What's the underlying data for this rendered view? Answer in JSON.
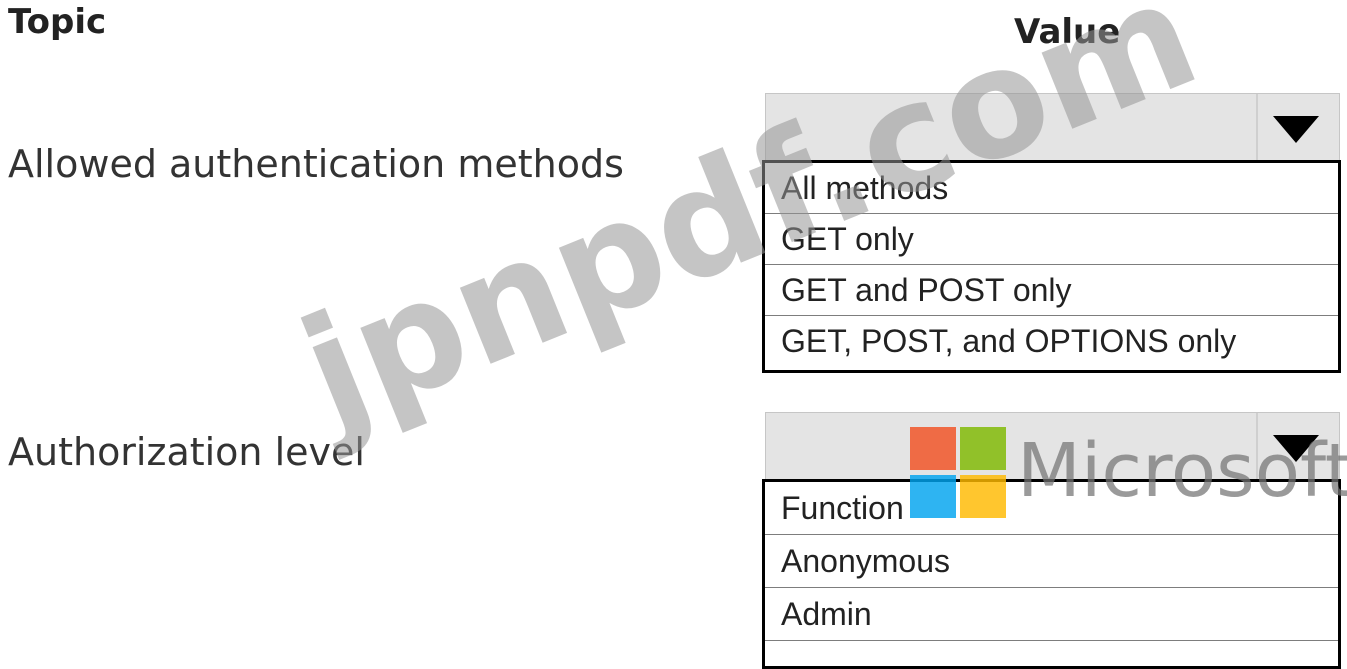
{
  "headers": {
    "topic": "Topic",
    "value": "Value"
  },
  "topics": [
    {
      "label": "Allowed authentication methods",
      "selected_value": "",
      "options": [
        "All methods",
        "GET only",
        "GET and POST only",
        "GET, POST, and OPTIONS only"
      ]
    },
    {
      "label": "Authorization level",
      "selected_value": "",
      "options": [
        "Function",
        "Anonymous",
        "Admin"
      ]
    }
  ],
  "watermark": {
    "site_text": "jpnpdf.com",
    "brand_text": "Microsoft",
    "brand_colors": [
      "#f25022",
      "#7fba00",
      "#00a4ef",
      "#ffb900"
    ]
  },
  "icons": {
    "dropdown_arrow": "caret-down-icon",
    "brand_logo": "microsoft-logo-icon"
  }
}
